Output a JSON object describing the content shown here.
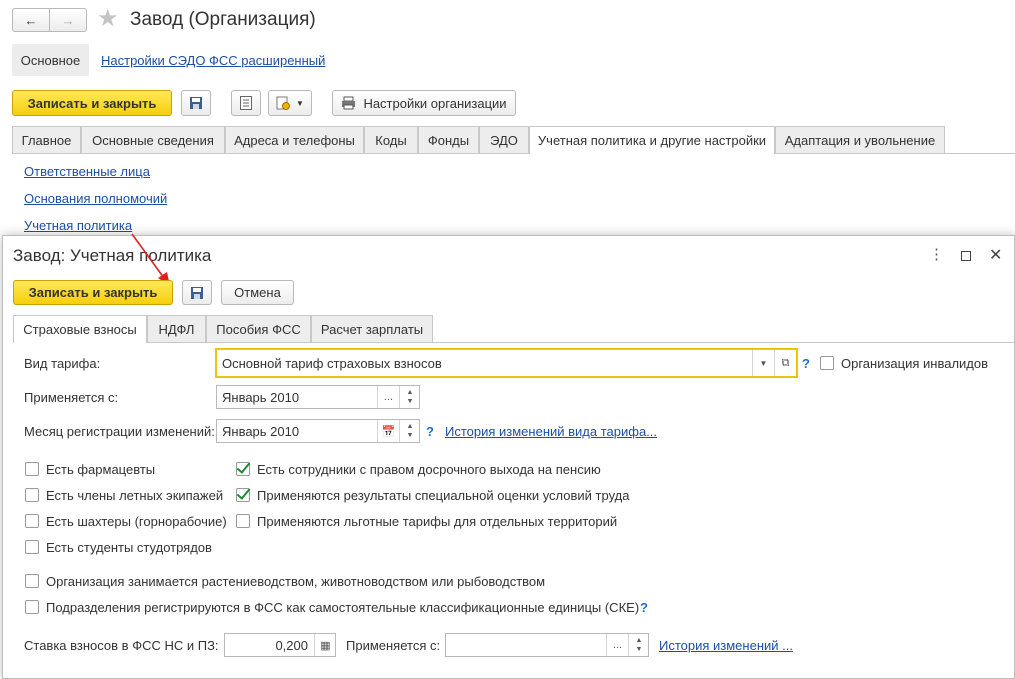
{
  "window": {
    "title": "Завод (Организация)",
    "nav_main": "Основное",
    "nav_link": "Настройки СЭДО ФСС расширенный",
    "save_close": "Записать и закрыть",
    "settings_button": "Настройки организации",
    "tabs": [
      "Главное",
      "Основные сведения",
      "Адреса и телефоны",
      "Коды",
      "Фонды",
      "ЭДО",
      "Учетная политика и другие настройки",
      "Адаптация и увольнение"
    ],
    "active_tab": 6,
    "links": [
      "Ответственные лица",
      "Основания полномочий",
      "Учетная политика"
    ]
  },
  "dialog": {
    "title": "Завод: Учетная политика",
    "save_close": "Записать и закрыть",
    "cancel": "Отмена",
    "tabs": [
      "Страховые взносы",
      "НДФЛ",
      "Пособия ФСС",
      "Расчет зарплаты"
    ],
    "active_tab": 0,
    "tariff_label": "Вид тарифа:",
    "tariff_value": "Основной тариф страховых взносов",
    "tariff_help": "?",
    "invalid_org_label": "Организация инвалидов",
    "applies_from_label": "Применяется с:",
    "applies_from_value": "Январь 2010",
    "reg_month_label": "Месяц регистрации изменений:",
    "reg_month_value": "Январь 2010",
    "reg_help": "?",
    "history_link": "История изменений вида тарифа...",
    "checkboxes_left": [
      {
        "label": "Есть фармацевты",
        "checked": false
      },
      {
        "label": "Есть члены летных экипажей",
        "checked": false
      },
      {
        "label": "Есть шахтеры (горнорабочие)",
        "checked": false
      },
      {
        "label": "Есть студенты студотрядов",
        "checked": false
      }
    ],
    "checkboxes_right": [
      {
        "label": "Есть сотрудники с правом досрочного выхода на пенсию",
        "checked": true
      },
      {
        "label": "Применяются результаты специальной оценки условий труда",
        "checked": true
      },
      {
        "label": "Применяются льготные тарифы для отдельных территорий",
        "checked": false
      }
    ],
    "checkbox_agri": {
      "label": "Организация занимается растениеводством, животноводством или рыбоводством",
      "checked": false
    },
    "checkbox_units": {
      "label": "Подразделения регистрируются в ФСС как самостоятельные классификационные единицы (СКЕ)",
      "checked": false
    },
    "units_help": "?",
    "rate_label": "Ставка взносов в ФСС НС и ПЗ:",
    "rate_value": "0,200",
    "rate_applies_label": "Применяется с:",
    "rate_applies_value": "",
    "rate_history_link": "История изменений ..."
  },
  "colors": {
    "primary_button": "#f5cf0c",
    "link": "#1d4fa3",
    "focus_border": "#f0c20c",
    "checkmark": "#1b8c2e"
  }
}
